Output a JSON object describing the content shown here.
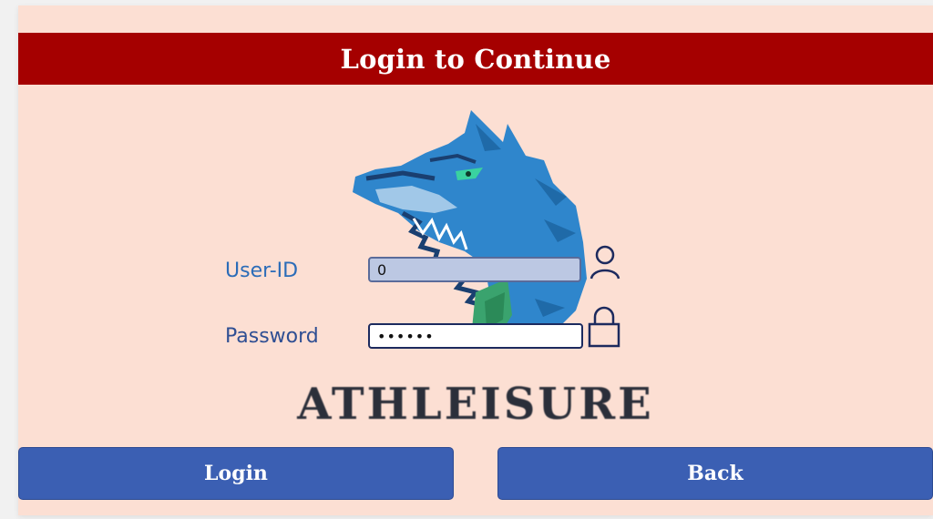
{
  "header": {
    "title": "Login to Continue"
  },
  "form": {
    "user_label": "User-ID",
    "user_value": "0",
    "password_label": "Password",
    "password_value": "••••••"
  },
  "brand": {
    "wordmark": "ATHLEISURE",
    "mascot": "wolf-mascot-logo"
  },
  "buttons": {
    "login_label": "Login",
    "back_label": "Back"
  },
  "icons": {
    "user": "user-icon",
    "lock": "lock-icon"
  },
  "colors": {
    "background": "#fcdfd3",
    "header": "#a50000",
    "button": "#3b5fb3",
    "label": "#2b6cb8",
    "mascot_blue": "#2f86cc",
    "mascot_green": "#3aa36e"
  }
}
